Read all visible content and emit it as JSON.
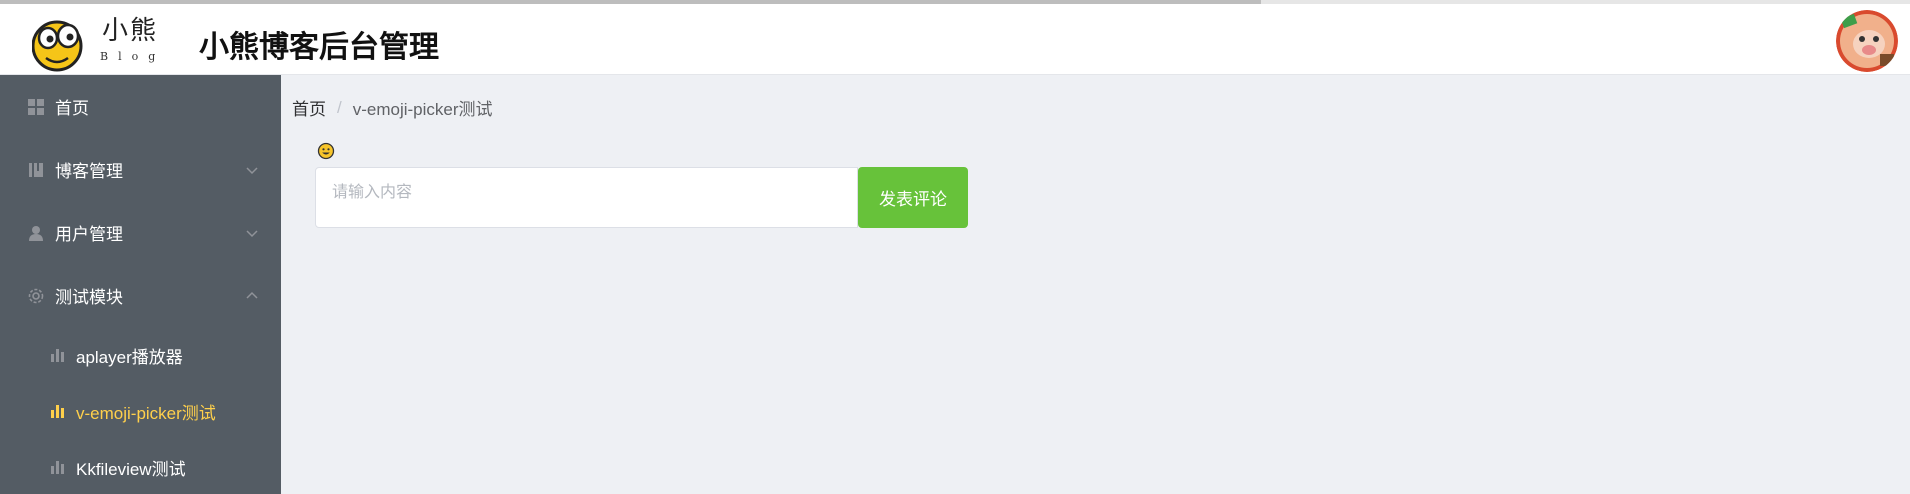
{
  "page_progress": 0.66,
  "header": {
    "logo_text": "小熊",
    "logo_sub": "Blog",
    "site_title": "小熊博客后台管理"
  },
  "sidebar": {
    "items": [
      {
        "label": "首页",
        "icon": "grid-icon"
      },
      {
        "label": "博客管理",
        "icon": "book-icon",
        "expandable": true,
        "expanded": false
      },
      {
        "label": "用户管理",
        "icon": "user-icon",
        "expandable": true,
        "expanded": false
      },
      {
        "label": "测试模块",
        "icon": "gear-icon",
        "expandable": true,
        "expanded": true
      }
    ],
    "sub_items": [
      {
        "label": "aplayer播放器",
        "icon": "bar-chart-icon",
        "active": false
      },
      {
        "label": "v-emoji-picker测试",
        "icon": "bar-chart-icon",
        "active": true
      },
      {
        "label": "Kkfileview测试",
        "icon": "bar-chart-icon",
        "active": false
      }
    ]
  },
  "breadcrumb": {
    "home": "首页",
    "separator": "/",
    "current": "v-emoji-picker测试"
  },
  "comment": {
    "value": "",
    "placeholder": "请输入内容",
    "submit_label": "发表评论"
  },
  "colors": {
    "sidebar_bg": "#545c64",
    "active_menu": "#ffd04b",
    "submit_green": "#67c23a",
    "content_bg": "#eef0f4"
  }
}
